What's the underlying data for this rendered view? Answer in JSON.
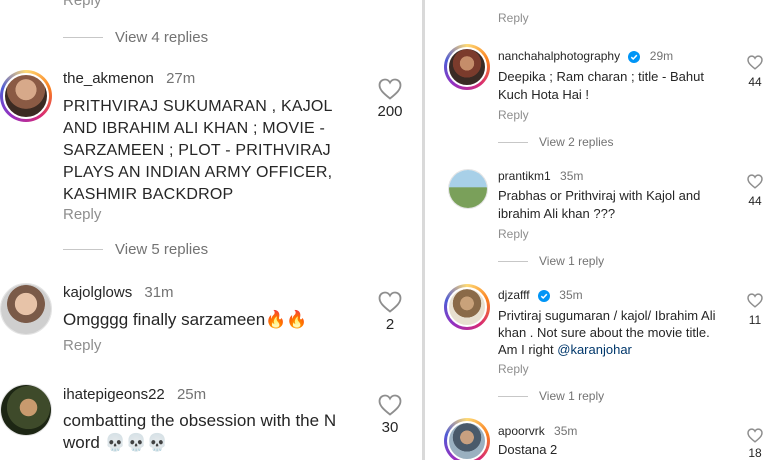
{
  "left": {
    "top_reply": "Reply",
    "view_replies_1": "View 4 replies",
    "comments": [
      {
        "username": "the_akmenon",
        "time": "27m",
        "lines": [
          "PRITHVIRAJ SUKUMARAN , KAJOL",
          "AND IBRAHIM ALI KHAN ; MOVIE -",
          "SARZAMEEN ; PLOT - PRITHVIRAJ",
          "PLAYS AN INDIAN ARMY OFFICER,",
          "KASHMIR BACKDROP"
        ],
        "reply": "Reply",
        "likes": "200",
        "view_replies": "View 5 replies"
      },
      {
        "username": "kajolglows",
        "time": "31m",
        "text": "Omgggg finally sarzameen🔥🔥",
        "reply": "Reply",
        "likes": "2"
      },
      {
        "username": "ihatepigeons22",
        "time": "25m",
        "lines": [
          "combatting the obsession with the N",
          "word 💀💀💀"
        ],
        "likes": "30"
      }
    ]
  },
  "right": {
    "top_reply": "Reply",
    "comments": [
      {
        "username": "nanchahalphotography",
        "time": "29m",
        "verified": true,
        "lines": [
          "Deepika ; Ram charan ; title - Bahut",
          "Kuch Hota Hai !"
        ],
        "reply": "Reply",
        "likes": "44",
        "view_replies": "View 2 replies"
      },
      {
        "username": "prantikm1",
        "time": "35m",
        "lines": [
          "Prabhas or Prithviraj with Kajol and",
          "ibrahim Ali khan ???"
        ],
        "reply": "Reply",
        "likes": "44",
        "view_replies": "View 1 reply"
      },
      {
        "username": "djzafff",
        "time": "35m",
        "verified": true,
        "lines": [
          "Privtiraj sugumaran / kajol/ Ibrahim Ali",
          "khan . Not sure about the movie title.",
          "Am I right"
        ],
        "mention": "@karanjohar",
        "reply": "Reply",
        "likes": "11",
        "view_replies": "View 1 reply"
      },
      {
        "username": "apoorvrk",
        "time": "35m",
        "text": "Dostana 2",
        "likes": "18"
      }
    ]
  },
  "colors": {
    "link": "#00376b",
    "muted": "#8e8e8e",
    "text": "#262626",
    "verified": "#0095f6"
  }
}
